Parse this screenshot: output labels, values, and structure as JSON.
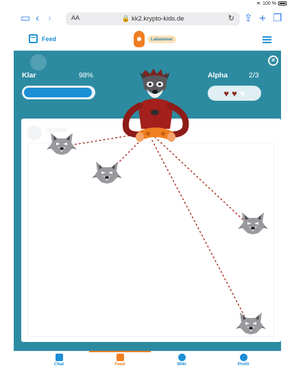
{
  "status": {
    "battery": "100 %"
  },
  "browser": {
    "text_size": "AA",
    "url": "kk2.krypto-kids.de"
  },
  "header": {
    "feed_label": "Feed",
    "logo_bubble": "Labalama!"
  },
  "game": {
    "klar_label": "Klar",
    "klar_percent_text": "98%",
    "klar_progress": 0.98,
    "alpha_label": "Alpha",
    "alpha_count": "2/3",
    "hearts_filled": 2,
    "hearts_total": 3,
    "wolf_icon": "wolf-head-icon",
    "background_color": "#2d8ba1"
  },
  "bottom_nav": {
    "items": [
      {
        "label": "Chat",
        "icon": "chat-icon"
      },
      {
        "label": "Feed",
        "icon": "calendar-icon",
        "active": true
      },
      {
        "label": "Wiki",
        "icon": "wiki-icon"
      },
      {
        "label": "Profil",
        "icon": "profile-icon"
      }
    ]
  }
}
